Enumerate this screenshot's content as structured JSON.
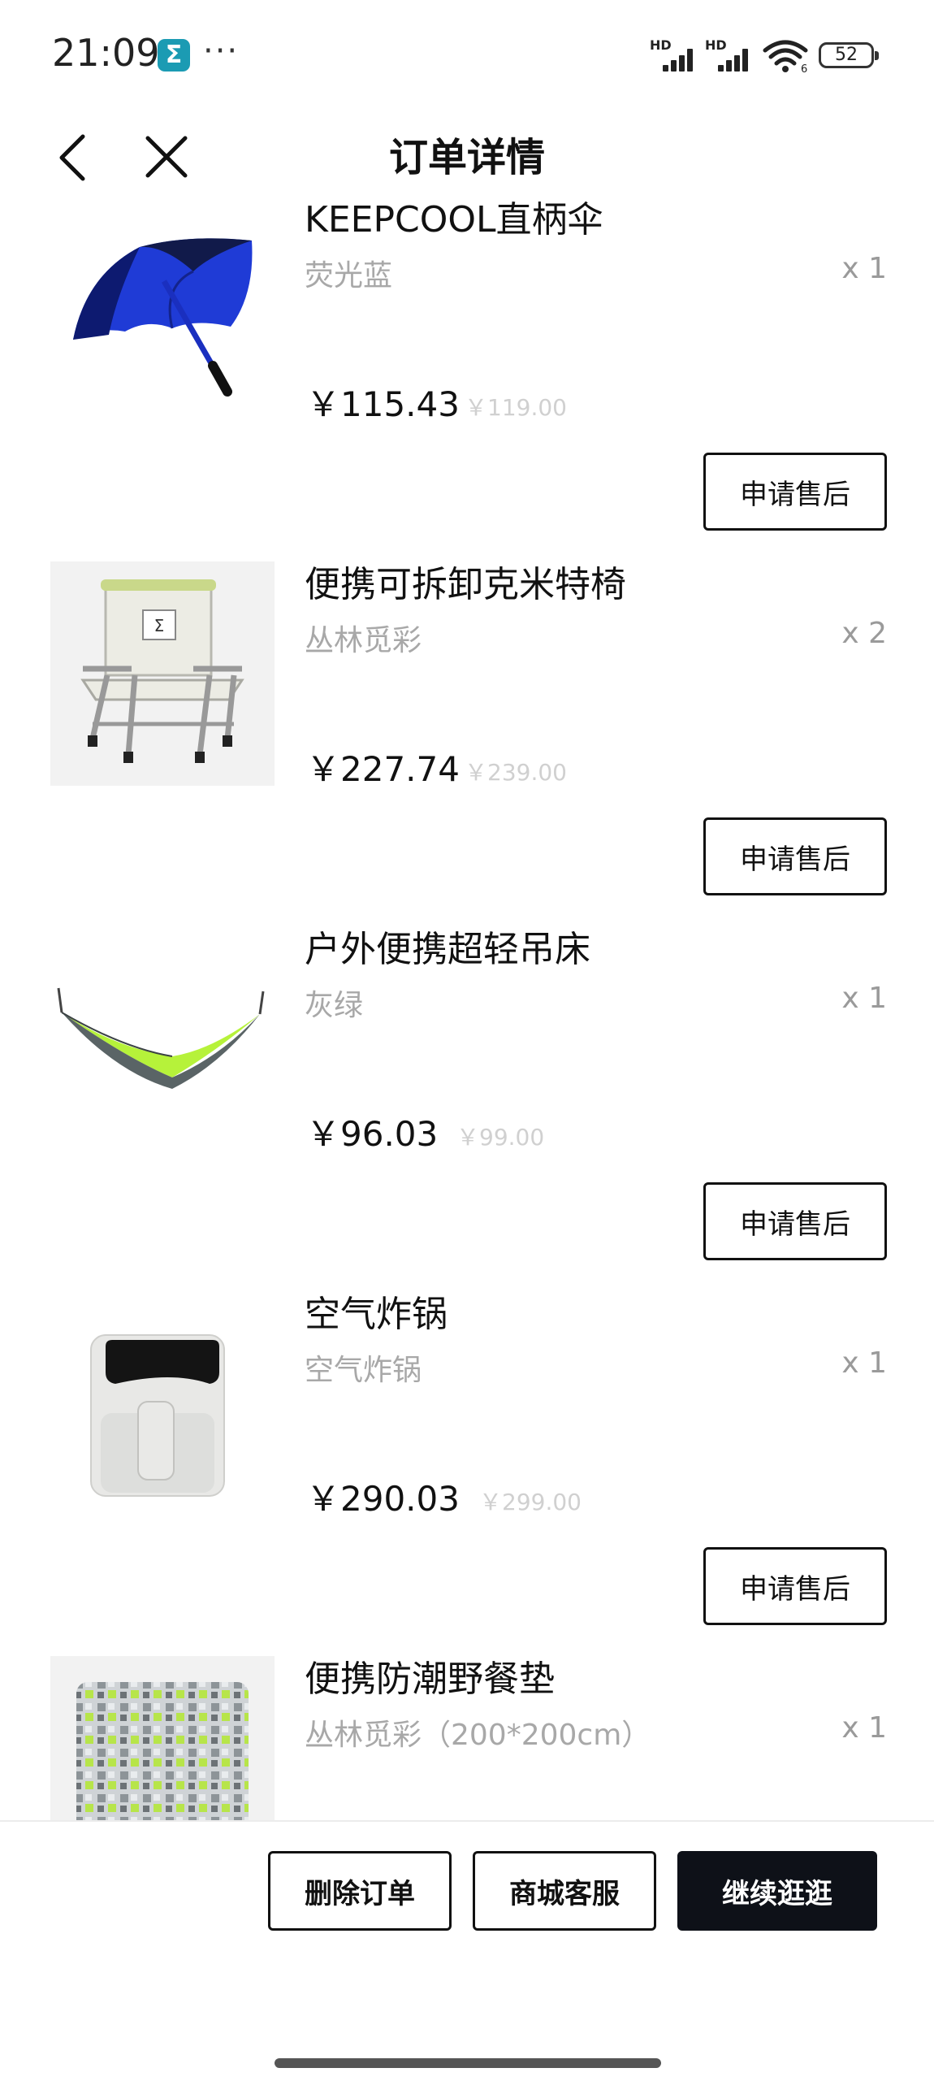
{
  "status_bar": {
    "time": "21:09",
    "app_badge": "Σ",
    "more": "···",
    "signal_1": "HD",
    "signal_2": "HD",
    "wifi_sub": "6",
    "battery": "52"
  },
  "nav": {
    "title": "订单详情",
    "back_icon": "chevron-left-icon",
    "close_icon": "close-icon"
  },
  "items": [
    {
      "name": "KEEPCOOL直柄伞",
      "spec": "荧光蓝",
      "qty": "x 1",
      "price": "￥115.43",
      "orig": "￥119.00",
      "action": "申请售后",
      "image": "umbrella"
    },
    {
      "name": "便携可拆卸克米特椅",
      "spec": "丛林觅彩",
      "qty": "x 2",
      "price": "￥227.74",
      "orig": "￥239.00",
      "action": "申请售后",
      "image": "chair"
    },
    {
      "name": "户外便携超轻吊床",
      "spec": "灰绿",
      "qty": "x 1",
      "price": "￥96.03",
      "orig": "￥99.00",
      "action": "申请售后",
      "image": "hammock"
    },
    {
      "name": "空气炸锅",
      "spec": "空气炸锅",
      "qty": "x 1",
      "price": "￥290.03",
      "orig": "￥299.00",
      "action": "申请售后",
      "image": "air-fryer"
    },
    {
      "name": "便携防潮野餐垫",
      "spec": "丛林觅彩（200*200cm）",
      "qty": "x 1",
      "price": "",
      "orig": "",
      "action": "",
      "image": "picnic-mat"
    }
  ],
  "bottom": {
    "delete_label": "删除订单",
    "service_label": "商城客服",
    "continue_label": "继续逛逛"
  },
  "colors": {
    "primary_button": "#0e1118",
    "muted_text": "#a8a8a8",
    "strike_price": "#d0d0d0",
    "umbrella_blue": "#1f3bd6",
    "hammock_green": "#b6f23a"
  }
}
